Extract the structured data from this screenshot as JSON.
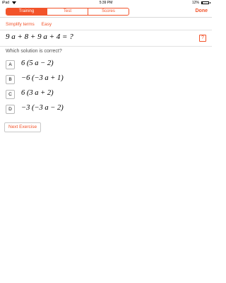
{
  "status_bar": {
    "device": "iPad",
    "time": "5:39 PM",
    "battery": "12%",
    "battery_level": 0.12
  },
  "header": {
    "tabs": [
      {
        "label": "Training",
        "active": true
      },
      {
        "label": "Test",
        "active": false
      },
      {
        "label": "Scores",
        "active": false
      }
    ],
    "done_label": "Done"
  },
  "topic": {
    "category": "Simplify terms",
    "difficulty": "Easy"
  },
  "question": {
    "expression": "9 a + 8 + 9 a + 4  =  ?",
    "help_label": "?",
    "prompt": "Which solution is correct?"
  },
  "options": [
    {
      "letter": "A",
      "answer": "6 (5 a − 2)"
    },
    {
      "letter": "B",
      "answer": "−6 (−3 a + 1)"
    },
    {
      "letter": "C",
      "answer": "6 (3 a + 2)"
    },
    {
      "letter": "D",
      "answer": "−3 (−3 a − 2)"
    }
  ],
  "next_button_label": "Next Exercise",
  "colors": {
    "accent": "#f2532a",
    "divider": "#e2e2e2"
  }
}
